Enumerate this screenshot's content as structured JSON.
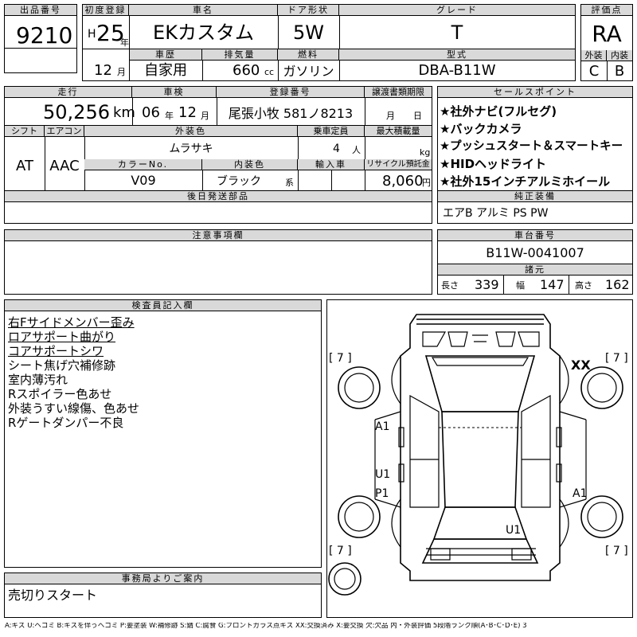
{
  "labels": {
    "lot": "出品番号",
    "first_reg": "初度登録",
    "car_name": "車名",
    "door": "ドア形状",
    "grade": "グレード",
    "score": "評価点",
    "history": "車歴",
    "displacement": "排気量",
    "fuel": "燃料",
    "model": "型式",
    "exterior_score": "外装",
    "interior_score": "内装",
    "mileage": "走行",
    "inspection": "車検",
    "plate": "登録番号",
    "transfer": "譲渡書類期限",
    "sales_points": "セールスポイント",
    "shift": "シフト",
    "aircon": "エアコン",
    "ext_color": "外装色",
    "capacity": "乗車定員",
    "max_load": "最大積載量",
    "color_no": "カラーNo.",
    "int_color": "内装色",
    "import": "輸入車",
    "recycle": "リサイクル預託金",
    "later_parts": "後日発送部品",
    "options": "純正装備",
    "notes": "注意事項欄",
    "chassis": "車台番号",
    "dims": "諸元",
    "inspector": "検査員記入欄",
    "office": "事務局よりご案内"
  },
  "units": {
    "year": "年",
    "month": "月",
    "cc": "cc",
    "km": "km",
    "people": "人",
    "kg": "kg",
    "yen": "円",
    "kei": "系",
    "length": "長さ",
    "width": "幅",
    "height": "高さ",
    "month_t": "月",
    "day_t": "日"
  },
  "vehicle": {
    "lot": "9210",
    "era": "H",
    "year": "25",
    "car_name": "EKカスタム",
    "door": "5W",
    "grade": "T",
    "score": "RA",
    "month": "12",
    "history": "自家用",
    "displacement": "660",
    "fuel": "ガソリン",
    "model": "DBA-B11W",
    "exterior": "C",
    "interior": "B",
    "mileage": "50,256",
    "insp_year": "06",
    "insp_month": "12",
    "plate": "尾張小牧 581ノ8213",
    "shift": "AT",
    "aircon": "AAC",
    "ext_color": "ムラサキ",
    "capacity": "4",
    "color_no": "V09",
    "int_color": "ブラック",
    "recycle": "8,060",
    "chassis": "B11W-0041007",
    "length": "339",
    "width": "147",
    "height": "162"
  },
  "sales_points": [
    "★社外ナビ(フルセグ)",
    "★バックカメラ",
    "★プッシュスタート＆スマートキー",
    "★HIDヘッドライト",
    "★社外15インチアルミホイール"
  ],
  "options": "エアB アルミ PS PW",
  "inspector_notes": [
    "右Fサイドメンバー歪み",
    "ロアサポート曲がり",
    "コアサポートシワ",
    "シート焦げ穴補修跡",
    "室内薄汚れ",
    "Rスポイラー色あせ",
    "外装うすい線傷、色あせ",
    "Rゲートダンパー不良"
  ],
  "office_note": "売切りスタート",
  "diagram": {
    "tire_fl": "[ 7 ]",
    "tire_fr": "[ 7 ]",
    "tire_rl": "[ 7 ]",
    "tire_rr": "[ 7 ]",
    "a1_left": "A1",
    "u1_left": "U1",
    "p1_left": "P1",
    "a1_right": "A1",
    "u1_rear": "U1",
    "xx": "XX"
  },
  "legend": "A:キズ U:ヘコミ B:キズを伴うヘコミ P:要塗装 W:補修跡 S:錆 C:腐食 G:フロントガラス点キズ XX:交換済み X:要交換 欠:欠品 内・外装評価 5段階ランク順(A･B･C･D･E) 3"
}
